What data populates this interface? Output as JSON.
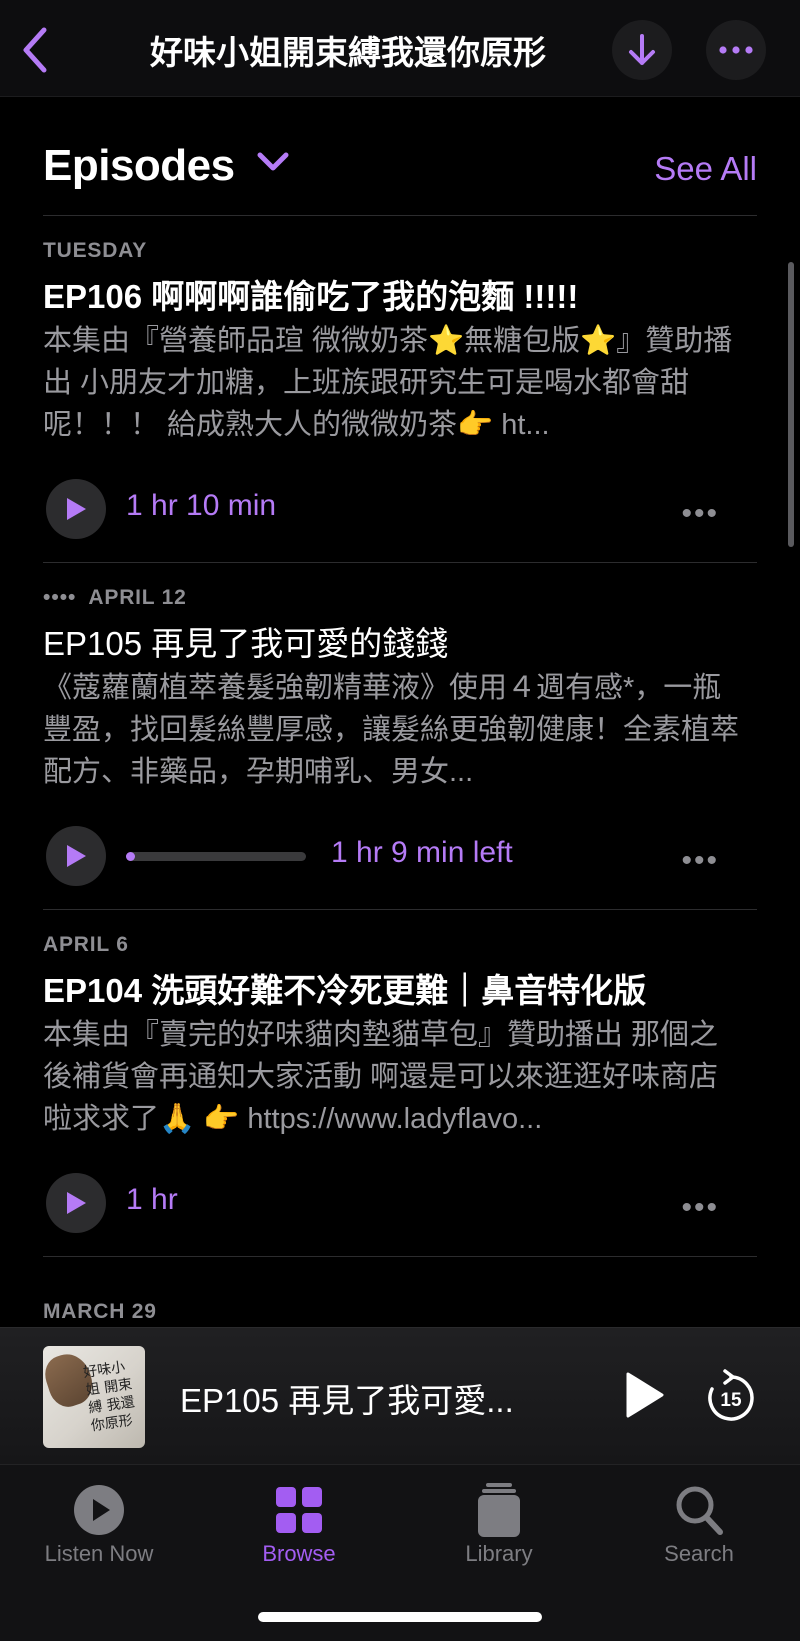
{
  "header": {
    "title": "好味小姐開束縛我還你原形",
    "back_icon": "chevron-left-icon",
    "download_icon": "download-arrow-icon",
    "more_icon": "ellipsis-icon"
  },
  "section": {
    "title": "Episodes",
    "see_all": "See All"
  },
  "colors": {
    "accent": "#b57bf6",
    "tab_active": "#a35df2",
    "secondary_text": "#8e8e93"
  },
  "episodes": [
    {
      "date": "TUESDAY",
      "title": "EP106 啊啊啊誰偷吃了我的泡麵 !!!!!",
      "description": "本集由『營養師品瑄 微微奶茶⭐無糖包版⭐』贊助播出 小朋友才加糖，上班族跟研究生可是喝水都會甜呢！！！ 給成熟大人的微微奶茶👉 ht...",
      "duration": "1 hr 10 min",
      "progress": null,
      "more": "•••"
    },
    {
      "date": "APRIL 12",
      "date_prefix": "••••",
      "title": "EP105 再見了我可愛的錢錢",
      "description": "《蔻蘿蘭植萃養髮強韌精華液》使用４週有感*，一瓶豐盈，找回髮絲豐厚感，讓髮絲更強韌健康！全素植萃配方、非藥品，孕期哺乳、男女...",
      "duration": "1 hr 9 min left",
      "progress": 0.05,
      "more": "•••"
    },
    {
      "date": "APRIL 6",
      "title": "EP104 洗頭好難不冷死更難｜鼻音特化版",
      "description": "本集由『賣完的好味貓肉墊貓草包』贊助播出 那個之後補貨會再通知大家活動 啊還是可以來逛逛好味商店啦求求了🙏 👉 https://www.ladyflavo...",
      "duration": "1 hr",
      "progress": null,
      "more": "•••"
    }
  ],
  "next_date": "MARCH 29",
  "mini_player": {
    "title": "EP105 再見了我可愛...",
    "artwork_text": "好味小姐 開束縛 我還你原形",
    "play_icon": "play-icon",
    "skip_icon": "skip-forward-15-icon",
    "skip_label": "15"
  },
  "tabs": [
    {
      "label": "Listen Now",
      "icon": "play-circle-icon",
      "active": false
    },
    {
      "label": "Browse",
      "icon": "grid-icon",
      "active": true
    },
    {
      "label": "Library",
      "icon": "stack-icon",
      "active": false
    },
    {
      "label": "Search",
      "icon": "magnifier-icon",
      "active": false
    }
  ]
}
